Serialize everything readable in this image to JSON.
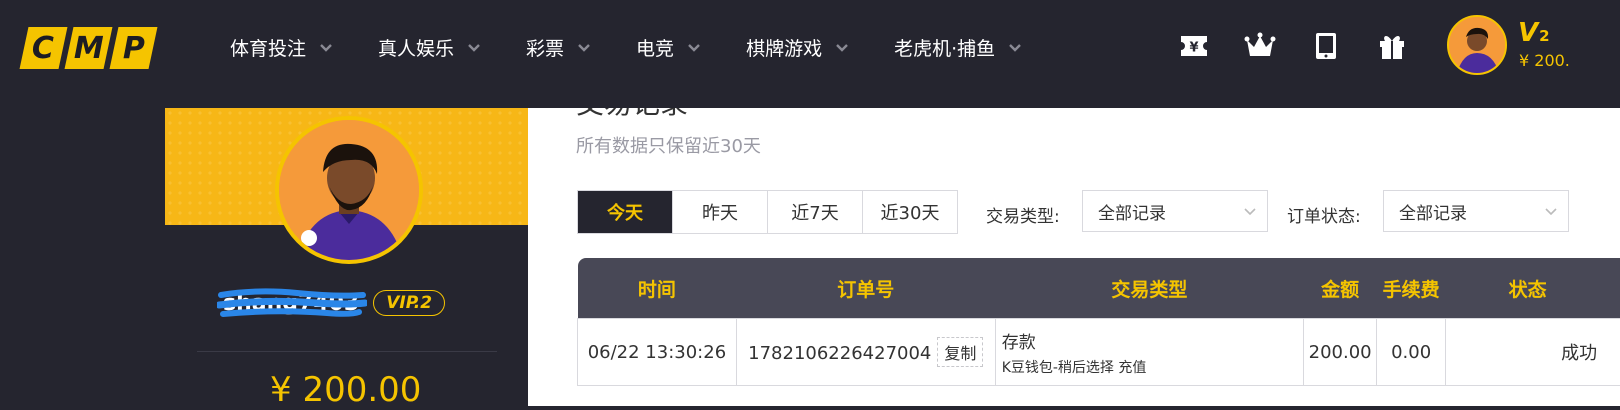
{
  "logo": {
    "letters": [
      "C",
      "M",
      "P"
    ]
  },
  "nav": [
    {
      "label": "体育投注"
    },
    {
      "label": "真人娱乐"
    },
    {
      "label": "彩票"
    },
    {
      "label": "电竞"
    },
    {
      "label": "棋牌游戏"
    },
    {
      "label": "老虎机·捕鱼"
    }
  ],
  "header_icons": [
    "ticket-yen-icon",
    "crown-icon",
    "tablet-icon",
    "gift-icon"
  ],
  "user": {
    "vip_mini": "V",
    "vip_level": "2",
    "balance_mini": "¥ 200.",
    "username": "shang7403",
    "vip_badge": "VIP.2",
    "balance": "¥ 200.00"
  },
  "page": {
    "title": "交易记录",
    "subtitle": "所有数据只保留近30天"
  },
  "date_range": [
    "今天",
    "昨天",
    "近7天",
    "近30天"
  ],
  "filters": {
    "type_label": "交易类型:",
    "type_value": "全部记录",
    "status_label": "订单状态:",
    "status_value": "全部记录"
  },
  "table": {
    "headers": [
      "时间",
      "订单号",
      "交易类型",
      "金额",
      "手续费",
      "状态"
    ],
    "rows": [
      {
        "time": "06/22 13:30:26",
        "order_no": "1782106226427004",
        "copy_label": "复制",
        "type": "存款",
        "type_detail": "K豆钱包-稍后选择 充值",
        "amount": "200.00",
        "fee": "0.00",
        "status": "成功"
      }
    ]
  },
  "colors": {
    "accent": "#f5c400",
    "dark": "#25252f",
    "header_row": "#484856",
    "success": "#2fa62c"
  }
}
